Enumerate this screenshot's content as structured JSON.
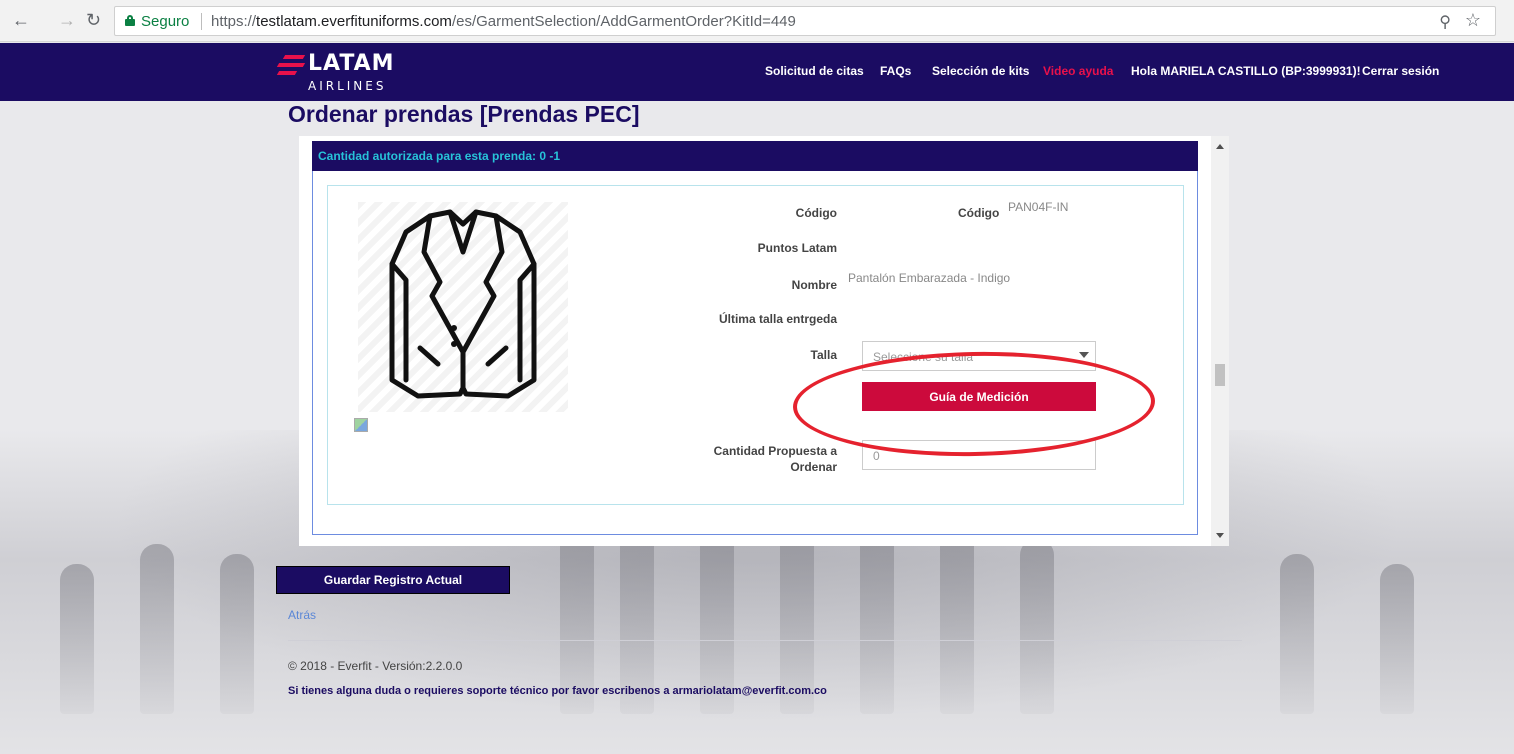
{
  "browser": {
    "secure_label": "Seguro",
    "url_scheme": "https://",
    "url_host": "testlatam.everfituniforms.com",
    "url_path": "/es/GarmentSelection/AddGarmentOrder?KitId=449",
    "icons": {
      "back": "arrow-left-icon",
      "forward": "arrow-right-icon",
      "reload": "reload-icon",
      "zoom": "zoom-icon",
      "bookmark": "star-icon"
    }
  },
  "header": {
    "logo_text": "LATAM",
    "logo_subtext": "AIRLINES",
    "nav": {
      "appointments": "Solicitud de citas",
      "faqs": "FAQs",
      "kits": "Selección de kits",
      "video_help": "Video ayuda",
      "greeting": "Hola MARIELA CASTILLO (BP:3999931)!",
      "logout": "Cerrar sesión"
    }
  },
  "page": {
    "title": "Ordenar prendas [Prendas PEC]"
  },
  "panel": {
    "header": "Cantidad autorizada para esta prenda: 0 -1",
    "fields": {
      "code_label": "Código",
      "code_label_2": "Código",
      "code_value": "PAN04F-IN",
      "points_label": "Puntos Latam",
      "name_label": "Nombre",
      "name_value": "Pantalón Embarazada - Indigo",
      "last_size_label": "Última talla entrgeda",
      "size_label": "Talla",
      "size_placeholder": "Seleccione su talla",
      "measure_button": "Guía de Medición",
      "qty_label_line1": "Cantidad Propuesta a",
      "qty_label_line2": "Ordenar",
      "qty_value": "0"
    }
  },
  "actions": {
    "save": "Guardar Registro Actual",
    "back": "Atrás"
  },
  "footer": {
    "copyright": "© 2018 - Everfit - Versión:2.2.0.0",
    "support": "Si tienes alguna duda o requieres soporte técnico por favor escribenos a armariolatam@everfit.com.co"
  },
  "colors": {
    "brand_navy": "#1b0c62",
    "accent_red": "#cc0a3c",
    "header_text_cyan": "#27c3d8",
    "annotation_red": "#e5222e"
  }
}
